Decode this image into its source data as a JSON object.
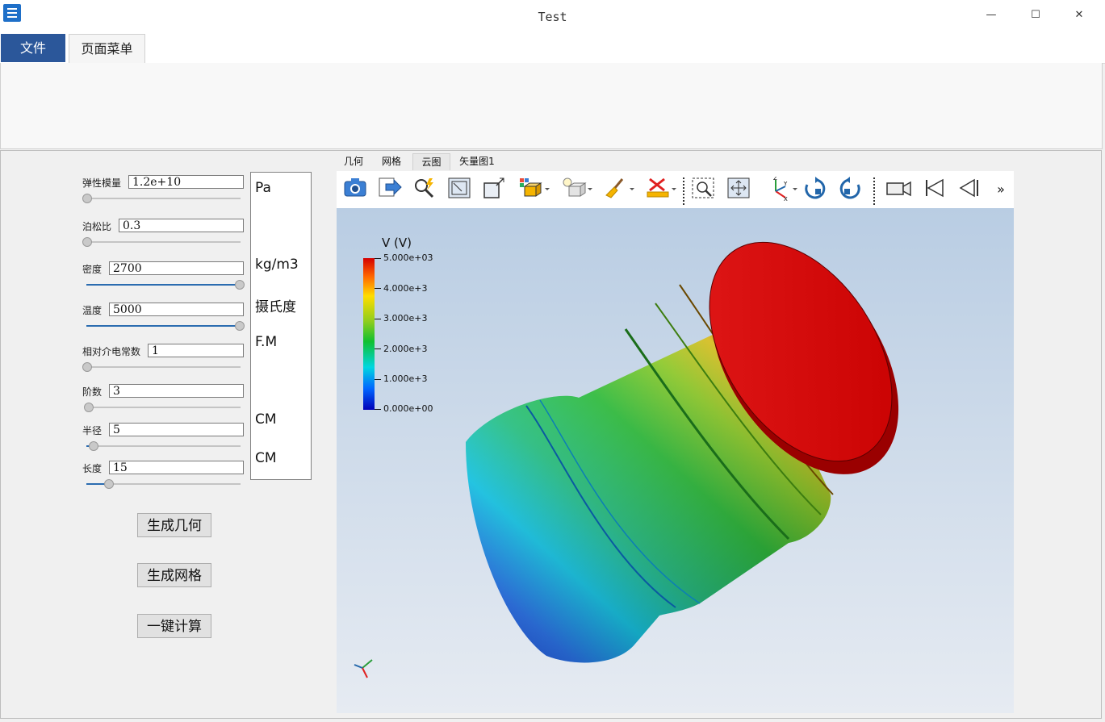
{
  "window": {
    "title": "Test",
    "minimize": "—",
    "maximize": "☐",
    "close": "✕"
  },
  "menu": {
    "file": "文件",
    "page_menu": "页面菜单"
  },
  "params": [
    {
      "label": "弹性模量",
      "value": "1.2e+10",
      "slider": 0.0
    },
    {
      "label": "泊松比",
      "value": "0.3",
      "slider": 0.0
    },
    {
      "label": "密度",
      "value": "2700",
      "slider": 1.0
    },
    {
      "label": "温度",
      "value": "5000",
      "slider": 1.0
    },
    {
      "label": "相对介电常数",
      "value": "1",
      "slider": 0.0
    },
    {
      "label": "阶数",
      "value": "3",
      "slider": 0.0
    },
    {
      "label": "半径",
      "value": "5",
      "slider": 0.04
    },
    {
      "label": "长度",
      "value": "15",
      "slider": 0.14
    }
  ],
  "units": [
    "Pa",
    "kg/m3",
    "摄氏度",
    "F.M",
    "CM",
    "CM"
  ],
  "buttons": {
    "gen_geometry": "生成几何",
    "gen_mesh": "生成网格",
    "compute": "一键计算"
  },
  "view_tabs": [
    "几何",
    "网格",
    "云图",
    "矢量图1"
  ],
  "active_view_tab": "云图",
  "toolbar_icons": [
    "camera-icon",
    "export-icon",
    "zoom-magic-icon",
    "fit-box-icon",
    "resize-box-icon",
    "display-mode-icon",
    "light-icon",
    "clean-brush-icon",
    "delete-measure-icon",
    "zoom-window-icon",
    "fit-all-icon",
    "axis-orientation-icon",
    "rotate-cw-icon",
    "rotate-ccw-icon",
    "camera-video-icon",
    "first-frame-icon",
    "prev-frame-icon",
    "more-icon"
  ],
  "legend": {
    "title": "V (V)",
    "ticks": [
      "5.000e+03",
      "4.000e+3",
      "3.000e+3",
      "2.000e+3",
      "1.000e+3",
      "0.000e+00"
    ]
  }
}
